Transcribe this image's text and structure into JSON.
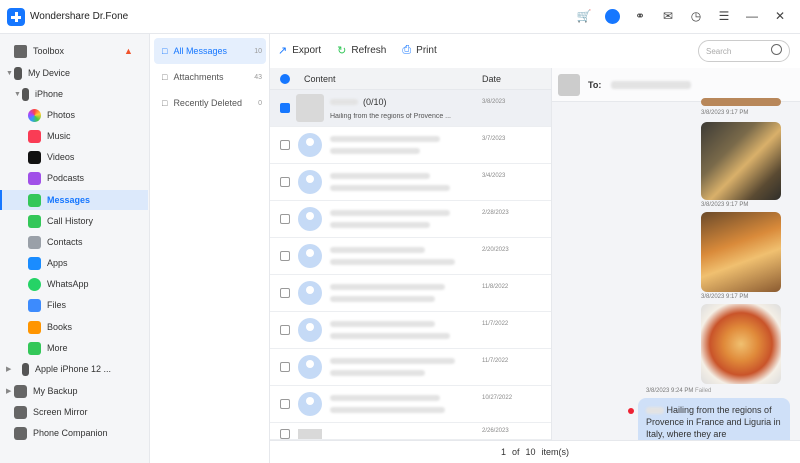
{
  "app": {
    "title": "Wondershare Dr.Fone"
  },
  "sidebar": {
    "toolbox": "Toolbox",
    "my_device": "My Device",
    "iphone": "iPhone",
    "items": [
      "Photos",
      "Music",
      "Videos",
      "Podcasts",
      "Messages",
      "Call History",
      "Contacts",
      "Apps",
      "WhatsApp",
      "Files",
      "Books",
      "More"
    ],
    "apple_iphone": "Apple iPhone 12 ...",
    "my_backup": "My Backup",
    "screen_mirror": "Screen Mirror",
    "phone_companion": "Phone Companion"
  },
  "categories": [
    {
      "label": "All Messages",
      "count": "10"
    },
    {
      "label": "Attachments",
      "count": "43"
    },
    {
      "label": "Recently Deleted",
      "count": "0"
    }
  ],
  "toolbar": {
    "export": "Export",
    "refresh": "Refresh",
    "print": "Print",
    "search_placeholder": "Search"
  },
  "list": {
    "col_content": "Content",
    "col_date": "Date",
    "rows": [
      {
        "title": "(0/10)",
        "preview": "Hailing from the regions of Provence ...",
        "date": "3/8/2023"
      },
      {
        "date": "3/7/2023"
      },
      {
        "date": "3/4/2023"
      },
      {
        "date": "2/28/2023"
      },
      {
        "date": "2/20/2023"
      },
      {
        "date": "11/8/2022"
      },
      {
        "date": "11/7/2022"
      },
      {
        "date": "11/7/2022"
      },
      {
        "date": "10/27/2022"
      },
      {
        "date": "2/26/2023"
      }
    ]
  },
  "chat": {
    "to_label": "To:",
    "timestamps": [
      "3/8/2023 9:17 PM",
      "3/8/2023 9:17 PM",
      "3/8/2023 9:17 PM"
    ],
    "failed_time": "3/8/2023 9:24 PM",
    "failed_label": "Failed",
    "bubble_text": "Hailing from the regions of Provence in France and Liguria in Italy, where they are"
  },
  "pagination": {
    "page": "1",
    "of": "of",
    "total": "10",
    "items": "item(s)"
  }
}
